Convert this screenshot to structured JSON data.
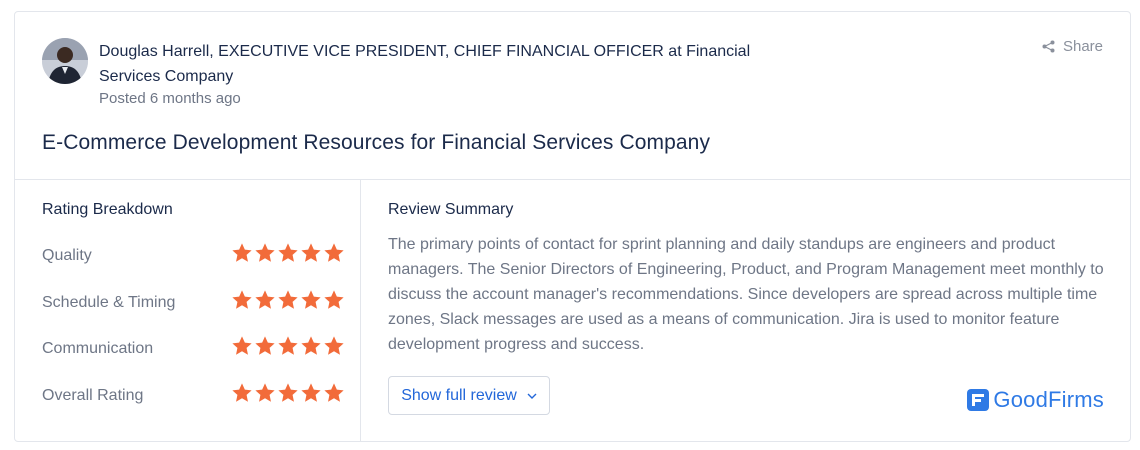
{
  "reviewer": {
    "line": "Douglas Harrell, EXECUTIVE VICE PRESIDENT, CHIEF FINANCIAL OFFICER at Financial Services Company",
    "posted": "Posted 6 months ago",
    "avatar_icon": "person-avatar"
  },
  "share": {
    "label": "Share",
    "icon": "share-icon"
  },
  "review": {
    "title": "E-Commerce Development Resources for Financial Services Company"
  },
  "breakdown": {
    "title": "Rating Breakdown",
    "star_color": "#f26b3a",
    "items": [
      {
        "label": "Quality",
        "stars": 5
      },
      {
        "label": "Schedule & Timing",
        "stars": 5
      },
      {
        "label": "Communication",
        "stars": 5
      },
      {
        "label": "Overall Rating",
        "stars": 5
      }
    ]
  },
  "summary": {
    "title": "Review Summary",
    "body": "The primary points of contact for sprint planning and daily standups are engineers and product managers. The Senior Directors of Engineering, Product, and Program Management meet monthly to discuss the account manager's recommendations. Since developers are spread across multiple time zones, Slack messages are used as a means of communication. Jira is used to monitor feature development progress and success."
  },
  "actions": {
    "show_full_review": "Show full review",
    "chevron": "chevron-down-icon"
  },
  "brand": {
    "name": "GoodFirms",
    "color": "#2f7ae5"
  }
}
